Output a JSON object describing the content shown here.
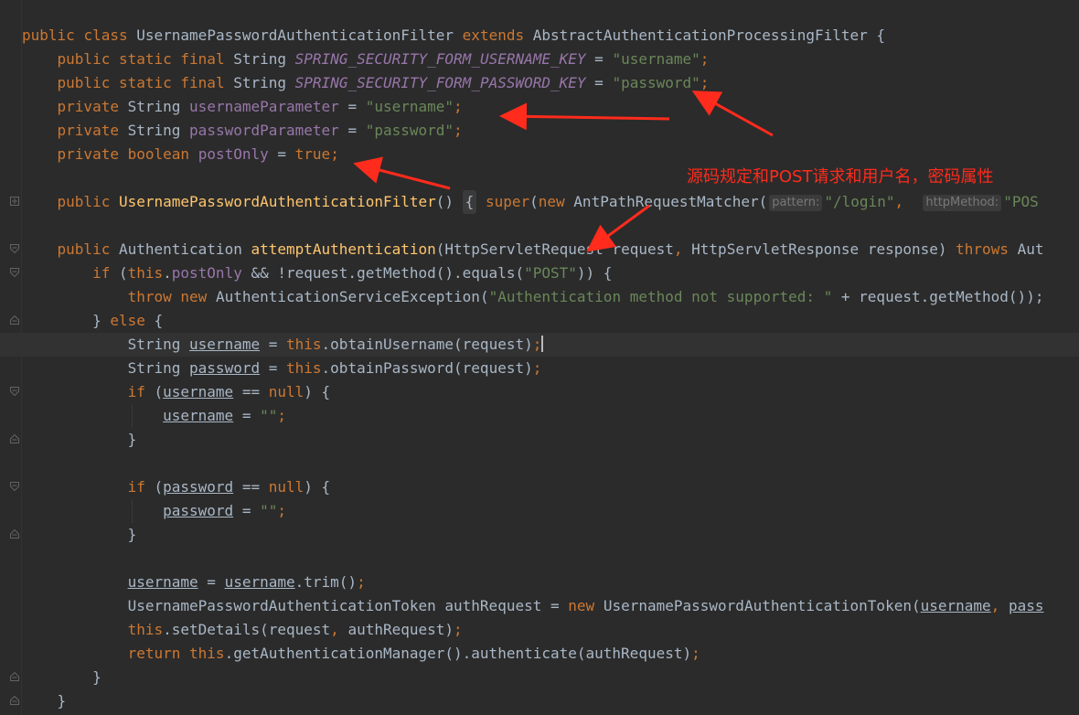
{
  "editor": {
    "language": "java",
    "annotation_text": "源码规定和POST请求和用户名，密码属性",
    "annotation_color": "#ff2b1c",
    "lines": [
      "public class UsernamePasswordAuthenticationFilter extends AbstractAuthenticationProcessingFilter {",
      "public static final String SPRING_SECURITY_FORM_USERNAME_KEY = \"username\";",
      "public static final String SPRING_SECURITY_FORM_PASSWORD_KEY = \"password\";",
      "private String usernameParameter = \"username\";",
      "private String passwordParameter = \"password\";",
      "private boolean postOnly = true;",
      "",
      "public UsernamePasswordAuthenticationFilter() { super(new AntPathRequestMatcher( pattern: \"/login\",  httpMethod: \"POS",
      "",
      "public Authentication attemptAuthentication(HttpServletRequest request, HttpServletResponse response) throws Aut",
      "if (this.postOnly && !request.getMethod().equals(\"POST\")) {",
      "throw new AuthenticationServiceException(\"Authentication method not supported: \" + request.getMethod());",
      "} else {",
      "String username = this.obtainUsername(request);",
      "String password = this.obtainPassword(request);",
      "if (username == null) {",
      "username = \"\";",
      "}",
      "",
      "if (password == null) {",
      "password = \"\";",
      "}",
      "",
      "username = username.trim();",
      "UsernamePasswordAuthenticationToken authRequest = new UsernamePasswordAuthenticationToken(username, pass",
      "this.setDetails(request, authRequest);",
      "return this.getAuthenticationManager().authenticate(authRequest);",
      "}",
      "}"
    ],
    "inlay_hints": [
      "pattern:",
      "httpMethod:"
    ]
  },
  "tokens": {
    "public": "public",
    "class": "class",
    "extends": "extends",
    "static": "static",
    "final": "final",
    "private": "private",
    "boolean": "boolean",
    "super": "super",
    "new": "new",
    "throws": "throws",
    "if": "if",
    "this": "this",
    "throw": "throw",
    "else": "else",
    "null": "null",
    "return": "return",
    "true": "true",
    "String": "String",
    "cls_filter": "UsernamePasswordAuthenticationFilter",
    "cls_abstract": "AbstractAuthenticationProcessingFilter",
    "const_user": "SPRING_SECURITY_FORM_USERNAME_KEY",
    "const_pass": "SPRING_SECURITY_FORM_PASSWORD_KEY",
    "str_username": "\"username\"",
    "str_password": "\"password\"",
    "fld_userParam": "usernameParameter",
    "fld_passParam": "passwordParameter",
    "fld_postOnly": "postOnly",
    "matcher": "AntPathRequestMatcher",
    "str_login": "\"/login\"",
    "str_pos": "\"POS",
    "Authentication": "Authentication",
    "fn_attempt": "attemptAuthentication",
    "HttpServletRequest": "HttpServletRequest",
    "request": "request",
    "HttpServletResponse": "HttpServletResponse",
    "response": "response",
    "Aut": "Aut",
    "getMethod": "request.getMethod().equals(",
    "str_post": "\"POST\"",
    "ase": "AuthenticationServiceException(",
    "str_msg": "\"Authentication method not supported: \"",
    "plus_getMethod": " + request.getMethod());",
    "username": "username",
    "password": "password",
    "obtainUsername": "obtainUsername(request)",
    "obtainPassword": "obtainPassword(request)",
    "str_empty": "\"\"",
    "trim": "trim()",
    "token_cls": "UsernamePasswordAuthenticationToken",
    "authRequest": "authRequest",
    "pass": "pass",
    "setDetails": "setDetails(request",
    "getAuthMgr": "getAuthenticationManager().authenticate(authRequest)"
  }
}
